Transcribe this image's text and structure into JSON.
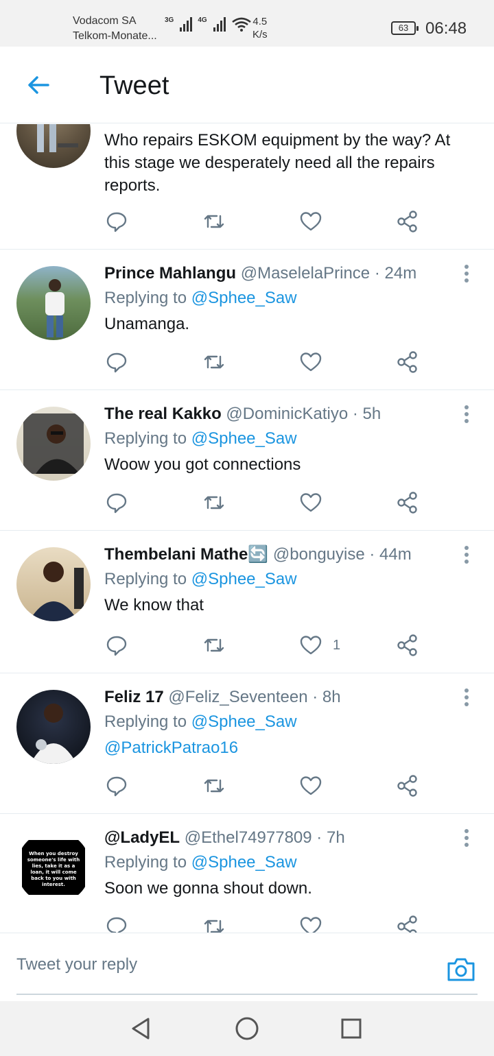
{
  "status_bar": {
    "carrier_1": "Vodacom SA",
    "carrier_2": "Telkom-Monate...",
    "net_1": "3G",
    "net_2": "4G",
    "speed_value": "4.5",
    "speed_unit": "K/s",
    "battery": "63",
    "time": "06:48"
  },
  "header": {
    "back_icon": "arrow-left-icon",
    "title": "Tweet"
  },
  "colors": {
    "accent": "#1b95e0",
    "secondary_text": "#657786",
    "divider": "#e6ecf0"
  },
  "tweets": [
    {
      "text": "Who repairs ESKOM equipment by the way? At this stage we desperately need all the repairs reports."
    },
    {
      "name": "Prince Mahlangu",
      "handle": "@MaselelaPrince",
      "time": "24m",
      "reply_prefix": "Replying to",
      "reply_to": "@Sphee_Saw",
      "text": "Unamanga."
    },
    {
      "name": "The real Kakko",
      "handle": "@DominicKatiyo",
      "time": "5h",
      "reply_prefix": "Replying to",
      "reply_to": "@Sphee_Saw",
      "text": "Woow you got connections"
    },
    {
      "name": "Thembelani Mathe🔄",
      "handle": "@bonguyise",
      "time": "44m",
      "reply_prefix": "Replying to",
      "reply_to": "@Sphee_Saw",
      "text": "We know that",
      "like_count": "1"
    },
    {
      "name": "Feliz 17",
      "handle": "@Feliz_Seventeen",
      "time": "8h",
      "reply_prefix": "Replying to",
      "reply_to": "@Sphee_Saw",
      "text": "@PatrickPatrao16"
    },
    {
      "name": "@LadyEL",
      "handle": "@Ethel74977809",
      "time": "7h",
      "reply_prefix": "Replying to",
      "reply_to": "@Sphee_Saw",
      "text": "Soon we gonna shout down.",
      "avatar_text": "When you destroy someone's life with lies, take it as a loan, it will come back to you with interest."
    }
  ],
  "action_icons": [
    "reply-icon",
    "retweet-icon",
    "like-icon",
    "share-icon"
  ],
  "separator": "·",
  "reply_bar": {
    "placeholder": "Tweet your reply",
    "camera_icon": "camera-icon"
  },
  "nav_bar": {
    "icons": [
      "back-triangle-icon",
      "home-circle-icon",
      "recents-square-icon"
    ]
  }
}
